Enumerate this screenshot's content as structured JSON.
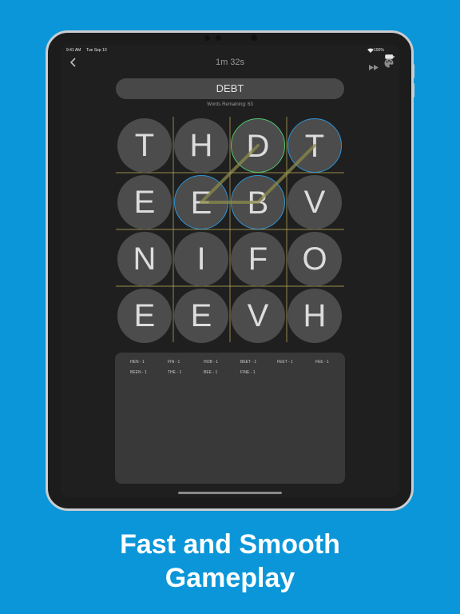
{
  "status_bar": {
    "time": "9:41 AM",
    "date": "Tue Sep 10",
    "battery": "100%"
  },
  "nav": {
    "timer": "1m 32s",
    "back_icon": "chevron-left-icon",
    "skip_icon": "fast-forward-icon",
    "theme_icon": "palette-icon"
  },
  "current_word": "DEBT",
  "words_remaining": "Words Remaining: 63",
  "board": {
    "rows": [
      [
        "T",
        "H",
        "D",
        "T"
      ],
      [
        "E",
        "E",
        "B",
        "V"
      ],
      [
        "N",
        "I",
        "F",
        "O"
      ],
      [
        "E",
        "E",
        "V",
        "H"
      ]
    ],
    "highlight_green": "#4ec96b",
    "highlight_blue": "#2e94d6"
  },
  "found_words": [
    "HEN - 1",
    "FIN - 1",
    "HOB - 1",
    "BEET - 1",
    "FEET - 1",
    "FEE - 1",
    "BEEN - 1",
    "THE - 1",
    "BEE - 1",
    "FINE - 1"
  ],
  "caption": {
    "line1": "Fast and Smooth",
    "line2": "Gameplay"
  }
}
